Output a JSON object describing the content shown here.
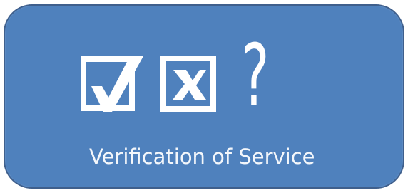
{
  "tile": {
    "caption": "Verification of Service",
    "question_glyph": "?",
    "icons": [
      "checkbox-checked-icon",
      "checkbox-x-icon",
      "question-mark-icon"
    ],
    "colors": {
      "background": "#4f81bd",
      "border": "#3f5f8c",
      "foreground": "#ffffff"
    }
  }
}
